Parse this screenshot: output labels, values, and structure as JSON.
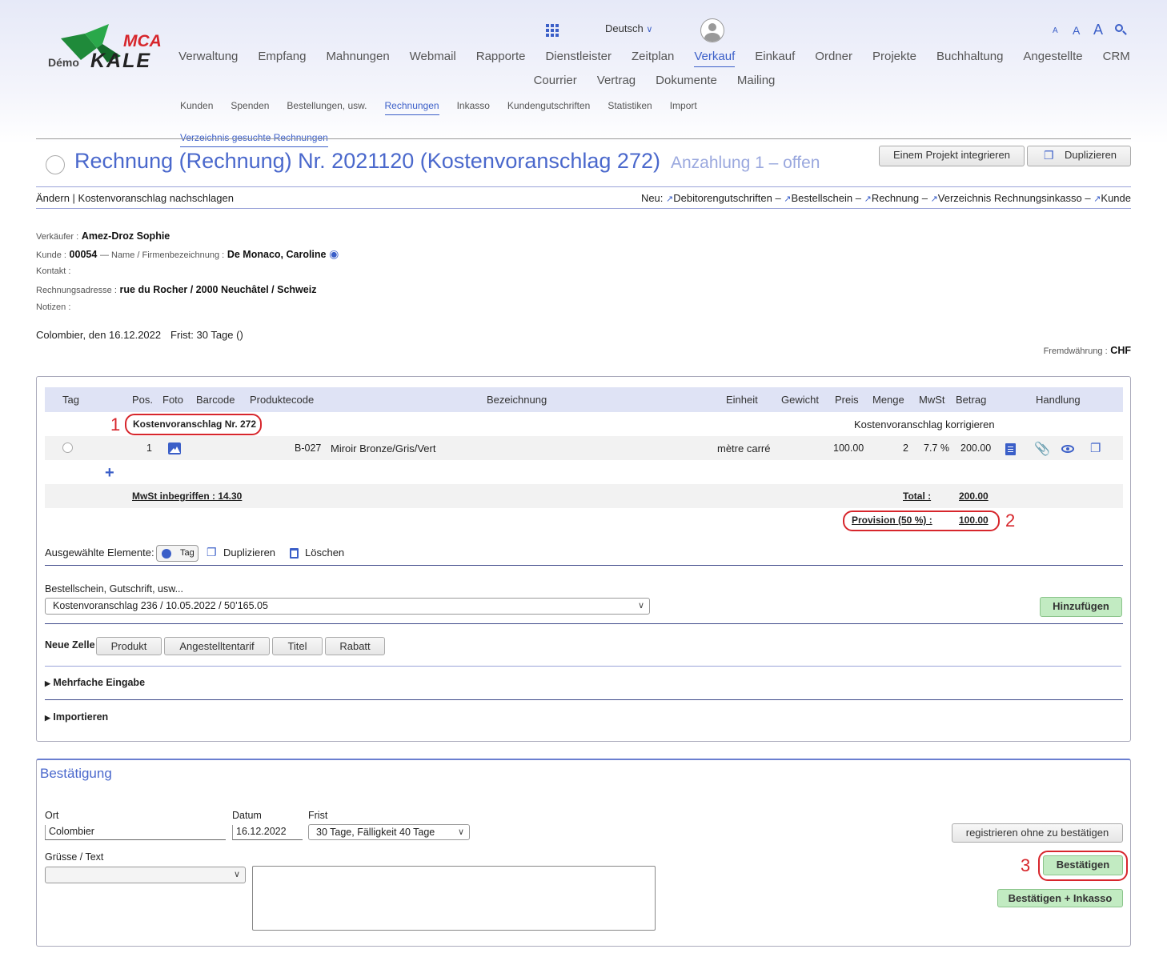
{
  "header": {
    "logo_mca": "MCA",
    "logo_demo": "Démo",
    "logo_kale": "KALE",
    "language": "Deutsch",
    "font_sizes": [
      "A",
      "A",
      "A"
    ]
  },
  "nav": [
    "Verwaltung",
    "Empfang",
    "Mahnungen",
    "Webmail",
    "Rapporte",
    "Dienstleister",
    "Zeitplan",
    "Verkauf",
    "Einkauf",
    "Ordner",
    "Projekte",
    "Buchhaltung",
    "Angestellte",
    "CRM",
    "Courrier",
    "Vertrag",
    "Dokumente",
    "Mailing"
  ],
  "nav_active": "Verkauf",
  "subnav": [
    "Kunden",
    "Spenden",
    "Bestellungen, usw.",
    "Rechnungen",
    "Inkasso",
    "Kundengutschriften",
    "Statistiken",
    "Import"
  ],
  "subnav_active": "Rechnungen",
  "subnav2": "Verzeichnis gesuchte Rechnungen",
  "page": {
    "title": "Rechnung (Rechnung) Nr. 2021120 (Kostenvoranschlag 272)",
    "status": "Anzahlung 1 – offen",
    "btn_integrate": "Einem Projekt integrieren",
    "btn_duplicate": "Duplizieren"
  },
  "actions": {
    "edit": "Ändern",
    "lookup": "Kostenvoranschlag nachschlagen",
    "new_label": "Neu:",
    "new_links": [
      "Debitorengutschriften",
      "Bestellschein",
      "Rechnung",
      "Verzeichnis Rechnungsinkasso",
      "Kunde"
    ]
  },
  "info": {
    "seller_label": "Verkäufer :",
    "seller": "Amez-Droz Sophie",
    "customer_label": "Kunde :",
    "customer_no": "00054",
    "name_label": "— Name / Firmenbezeichnung :",
    "customer_name": "De Monaco, Caroline",
    "contact_label": "Kontakt :",
    "address_label": "Rechnungsadresse :",
    "address": "rue du Rocher / 2000 Neuchâtel / Schweiz",
    "notes_label": "Notizen :",
    "place_date": "Colombier, den 16.12.2022",
    "deadline": "Frist: 30 Tage ()",
    "currency_label": "Fremdwährung :",
    "currency": "CHF"
  },
  "table": {
    "headers": [
      "Tag",
      "Pos.",
      "Foto",
      "Barcode",
      "Produktecode",
      "Bezeichnung",
      "Einheit",
      "Gewicht",
      "Preis",
      "Menge",
      "MwSt",
      "Betrag",
      "Handlung"
    ],
    "group_title": "Kostenvoranschlag Nr. 272",
    "group_action": "Kostenvoranschlag korrigieren",
    "row": {
      "pos": "1",
      "code": "B-027",
      "name": "Miroir Bronze/Gris/Vert",
      "unit": "mètre carré",
      "price": "100.00",
      "qty": "2",
      "vat": "7.7 %",
      "amount": "200.00"
    },
    "vat_incl": "MwSt inbegriffen : 14.30",
    "total_label": "Total :",
    "total": "200.00",
    "provision_label": "Provision (50 %) :",
    "provision": "100.00"
  },
  "selected": {
    "label": "Ausgewählte Elemente:",
    "tag": "Tag",
    "duplicate": "Duplizieren",
    "delete": "Löschen"
  },
  "order": {
    "label": "Bestellschein, Gutschrift, usw...",
    "value": "Kostenvoranschlag 236 / 10.05.2022 / 50’165.05",
    "add": "Hinzufügen"
  },
  "newcell": {
    "label": "Neue Zelle",
    "buttons": [
      "Produkt",
      "Angestelltentarif",
      "Titel",
      "Rabatt"
    ]
  },
  "multi_entry": "Mehrfache Eingabe",
  "import": "Importieren",
  "confirm": {
    "title": "Bestätigung",
    "place_label": "Ort",
    "place": "Colombier",
    "date_label": "Datum",
    "date": "16.12.2022",
    "deadline_label": "Frist",
    "deadline": "30 Tage, Fälligkeit 40 Tage",
    "greet_label": "Grüsse / Text",
    "register": "registrieren ohne zu bestätigen",
    "confirm_btn": "Bestätigen",
    "confirm_inkasso": "Bestätigen + Inkasso"
  },
  "annotations": [
    "1",
    "2",
    "3"
  ],
  "colors": {
    "accent": "#3b5fc8",
    "annotation": "#d7262c",
    "green": "#c2ebc2"
  }
}
